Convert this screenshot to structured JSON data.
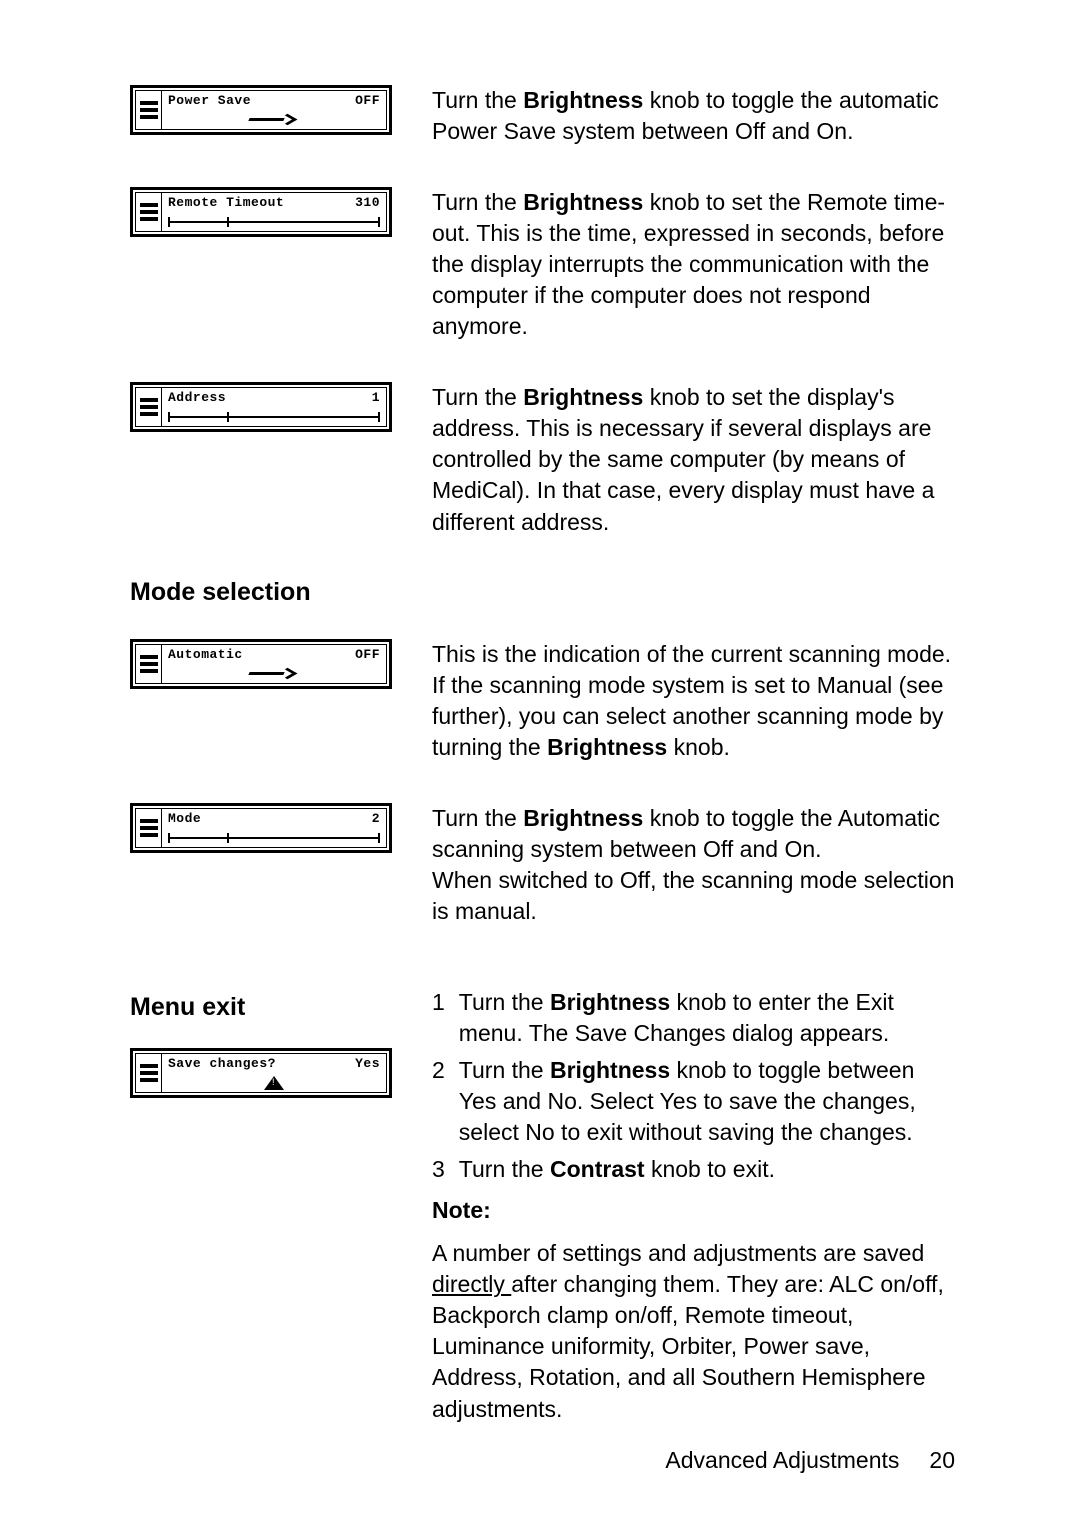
{
  "items": {
    "power_save": {
      "label": "Power Save",
      "value": "OFF",
      "desc_pre": "Turn the ",
      "desc_bold": "Brightness",
      "desc_post": " knob to toggle the automatic Power Save system between Off and On."
    },
    "remote_timeout": {
      "label": "Remote Timeout",
      "value": "310",
      "desc_pre": "Turn the ",
      "desc_bold": "Brightness",
      "desc_post": " knob to set the Remote time-out. This is the time, expressed in seconds, before the display interrupts the communication with the computer if the computer does not respond anymore."
    },
    "address": {
      "label": "Address",
      "value": "1",
      "desc_pre": "Turn the ",
      "desc_bold": "Brightness",
      "desc_post": " knob to set the display's address. This is necessary if several displays are controlled by the same computer (by means of MediCal). In that case, every display must have a different address."
    }
  },
  "mode_selection": {
    "heading": "Mode selection",
    "automatic": {
      "label": "Automatic",
      "value": "OFF",
      "desc_pre": "This is the indication of the current scanning mode. If the scanning mode system is set to Manual (see further), you can select another scanning mode by turning the ",
      "desc_bold": "Brightness",
      "desc_post": " knob."
    },
    "mode": {
      "label": "Mode",
      "value": "2",
      "desc_pre": "Turn the ",
      "desc_bold": "Brightness",
      "desc_post": " knob to toggle the Automatic scanning system between Off and On.",
      "desc_line2": "When switched to Off, the scanning mode selection is manual."
    }
  },
  "menu_exit": {
    "heading": "Menu exit",
    "save_changes": {
      "label": "Save changes?",
      "value": "Yes"
    },
    "steps": {
      "s1_pre": "Turn the ",
      "s1_bold": "Brightness",
      "s1_post": " knob to enter the Exit menu. The Save Changes dialog appears.",
      "s2_pre": "Turn the ",
      "s2_bold": "Brightness",
      "s2_post": " knob to toggle between Yes and No. Select Yes to save the changes, select No to exit without saving the changes.",
      "s3_pre": "Turn the ",
      "s3_bold": "Contrast",
      "s3_post": " knob to exit."
    },
    "note_label": "Note:",
    "note_body_pre": "A number of settings and adjustments are saved ",
    "note_body_underline": "directly ",
    "note_body_post": "after changing them. They are: ALC on/off, Backporch clamp on/off, Remote timeout, Luminance uniformity, Orbiter, Power save, Address, Rotation, and all Southern Hemisphere adjustments."
  },
  "footer": {
    "section": "Advanced Adjustments",
    "page": "20"
  }
}
